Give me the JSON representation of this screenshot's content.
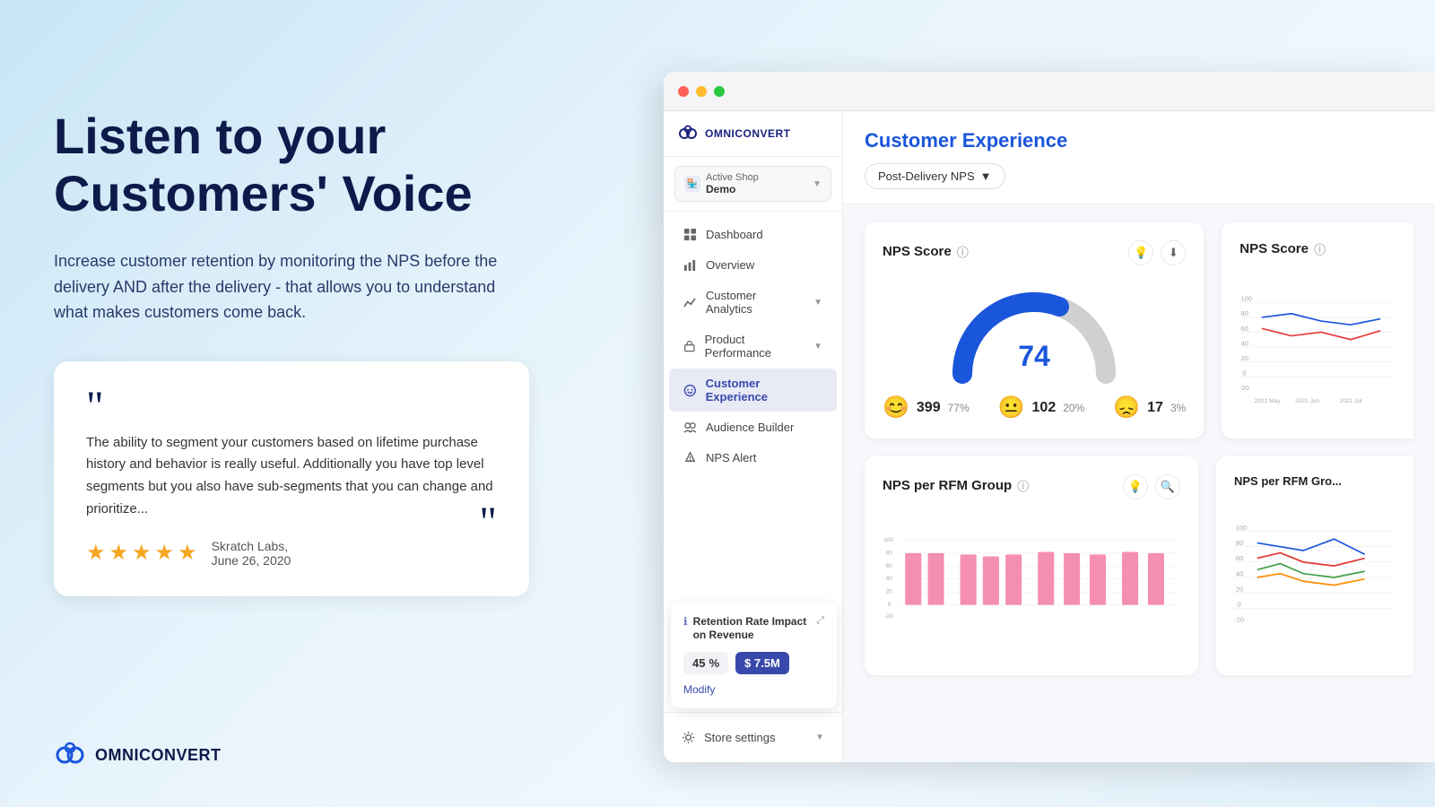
{
  "left": {
    "heading_line1": "Listen to your",
    "heading_line2": "Customers' Voice",
    "subtext": "Increase customer retention by monitoring the NPS before the delivery AND after the delivery - that allows you to understand what makes customers come back.",
    "quote": {
      "text": "The ability to segment your customers based on lifetime purchase history and behavior is really useful. Additionally you have top level segments but you also have sub-segments that you can change and prioritize...",
      "author": "Skratch Labs,",
      "date": "June 26, 2020",
      "stars": 5
    }
  },
  "bottom_logo": {
    "name": "OMNICONVERT"
  },
  "app": {
    "brand": "OMNICONVERT",
    "shop": {
      "name": "Active Shop",
      "sub": "Demo"
    },
    "nav": [
      {
        "label": "Dashboard",
        "icon": "grid",
        "active": false
      },
      {
        "label": "Overview",
        "icon": "bar-chart",
        "active": false
      },
      {
        "label": "Customer Analytics",
        "icon": "line-chart",
        "active": false,
        "has_chevron": true
      },
      {
        "label": "Product Performance",
        "icon": "box",
        "active": false,
        "has_chevron": true
      },
      {
        "label": "Customer Experience",
        "icon": "face-smile",
        "active": true
      },
      {
        "label": "Audience Builder",
        "icon": "users",
        "active": false
      },
      {
        "label": "NPS Alert",
        "icon": "bell",
        "active": false
      }
    ],
    "footer_nav": [
      {
        "label": "Store settings",
        "icon": "gear",
        "has_chevron": true
      }
    ],
    "retention_widget": {
      "title": "Retention Rate Impact on Revenue",
      "pct": "45",
      "pct_unit": "%",
      "revenue": "$ 7.5M",
      "modify_label": "Modify"
    },
    "main": {
      "title": "Customer Experience",
      "filter": "Post-Delivery NPS",
      "nps_card": {
        "title": "NPS Score",
        "score": 74,
        "promoters": {
          "count": 399,
          "pct": "77%"
        },
        "passives": {
          "count": 102,
          "pct": "20%"
        },
        "detractors": {
          "count": 17,
          "pct": "3%"
        }
      },
      "rfm_card": {
        "title": "NPS per RFM Group"
      },
      "right_nps": {
        "title": "NPS Score"
      },
      "right_rfm": {
        "title": "NPS per RFM Gro..."
      }
    }
  }
}
